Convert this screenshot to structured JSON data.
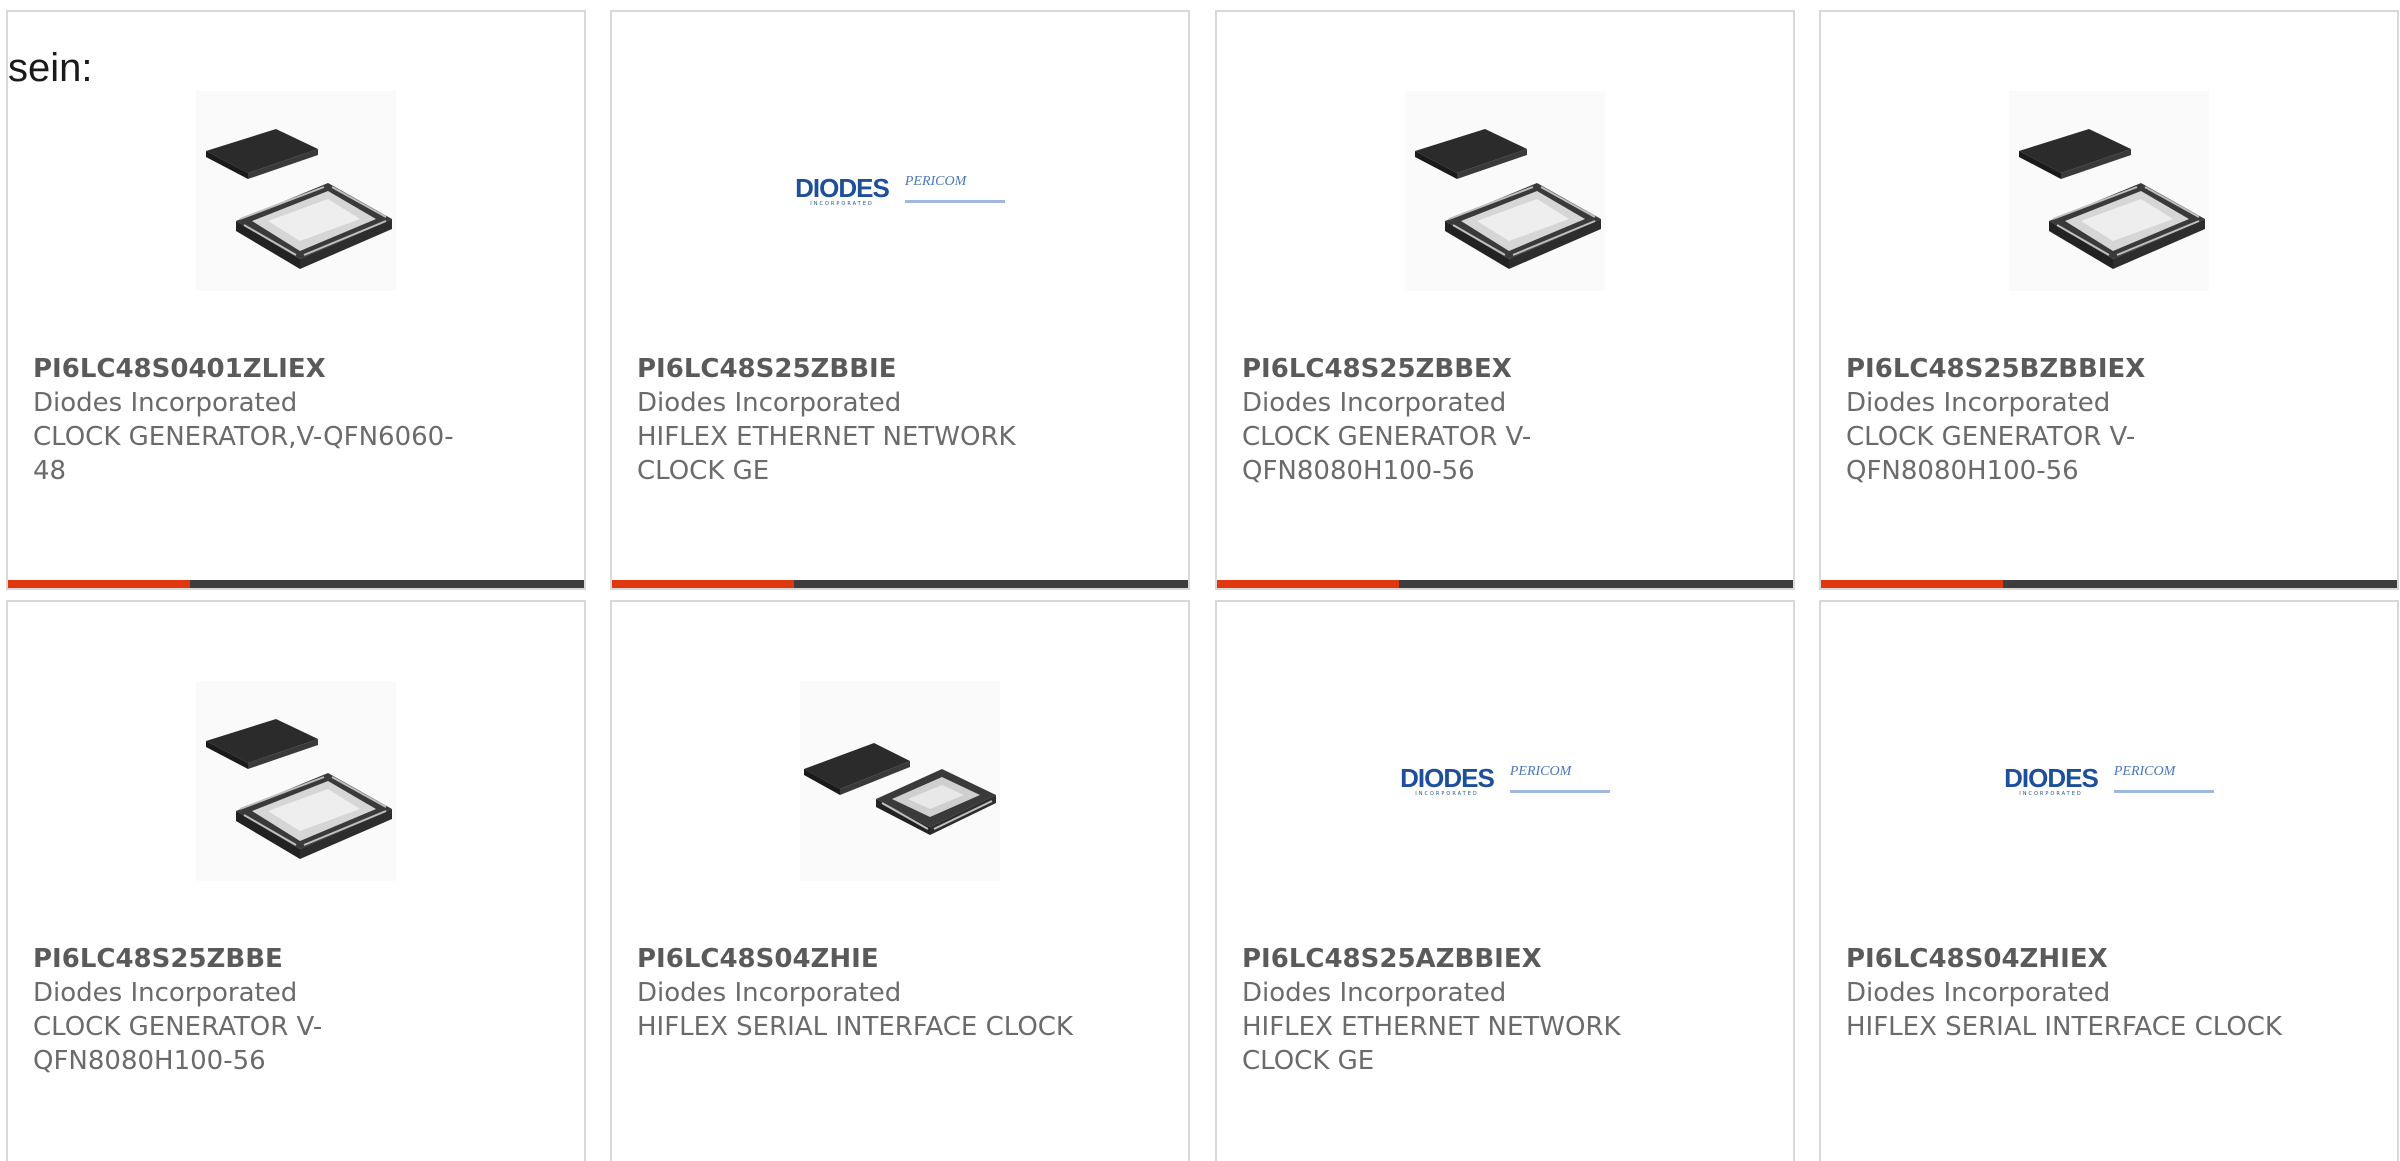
{
  "intro_text": "sein:",
  "colors": {
    "accent_bar": "#e0380e",
    "dark_bar": "#3d3d3d",
    "card_border": "#d8d8d8",
    "text_gray": "#6b6b6b",
    "diodes_blue": "#1d4f9a"
  },
  "logo": {
    "brand": "DIODES",
    "brand_sub": "INCORPORATED",
    "partner": "PERICOM"
  },
  "products": [
    {
      "part_number": "PI6LC48S0401ZLIEX",
      "manufacturer": "Diodes Incorporated",
      "description": "CLOCK GENERATOR,V-QFN6060-48",
      "image": "qfn-chip-large-icon",
      "has_bar": true
    },
    {
      "part_number": "PI6LC48S25ZBBIE",
      "manufacturer": "Diodes Incorporated",
      "description": "HIFLEX ETHERNET NETWORK CLOCK GE",
      "image": "diodes-pericom-logo",
      "has_bar": true
    },
    {
      "part_number": "PI6LC48S25ZBBEX",
      "manufacturer": "Diodes Incorporated",
      "description": "CLOCK GENERATOR V-QFN8080H100-56",
      "image": "qfn-chip-large-icon",
      "has_bar": true
    },
    {
      "part_number": "PI6LC48S25BZBBIEX",
      "manufacturer": "Diodes Incorporated",
      "description": "CLOCK GENERATOR V-QFN8080H100-56",
      "image": "qfn-chip-large-icon",
      "has_bar": true
    },
    {
      "part_number": "PI6LC48S25ZBBE",
      "manufacturer": "Diodes Incorporated",
      "description": "CLOCK GENERATOR V-QFN8080H100-56",
      "image": "qfn-chip-large-icon",
      "has_bar": false
    },
    {
      "part_number": "PI6LC48S04ZHIE",
      "manufacturer": "Diodes Incorporated",
      "description": "HIFLEX SERIAL INTERFACE CLOCK",
      "image": "qfn-chip-small-icon",
      "has_bar": false
    },
    {
      "part_number": "PI6LC48S25AZBBIEX",
      "manufacturer": "Diodes Incorporated",
      "description": "HIFLEX ETHERNET NETWORK CLOCK GE",
      "image": "diodes-pericom-logo",
      "has_bar": false
    },
    {
      "part_number": "PI6LC48S04ZHIEX",
      "manufacturer": "Diodes Incorporated",
      "description": "HIFLEX SERIAL INTERFACE CLOCK",
      "image": "diodes-pericom-logo",
      "has_bar": false
    }
  ]
}
